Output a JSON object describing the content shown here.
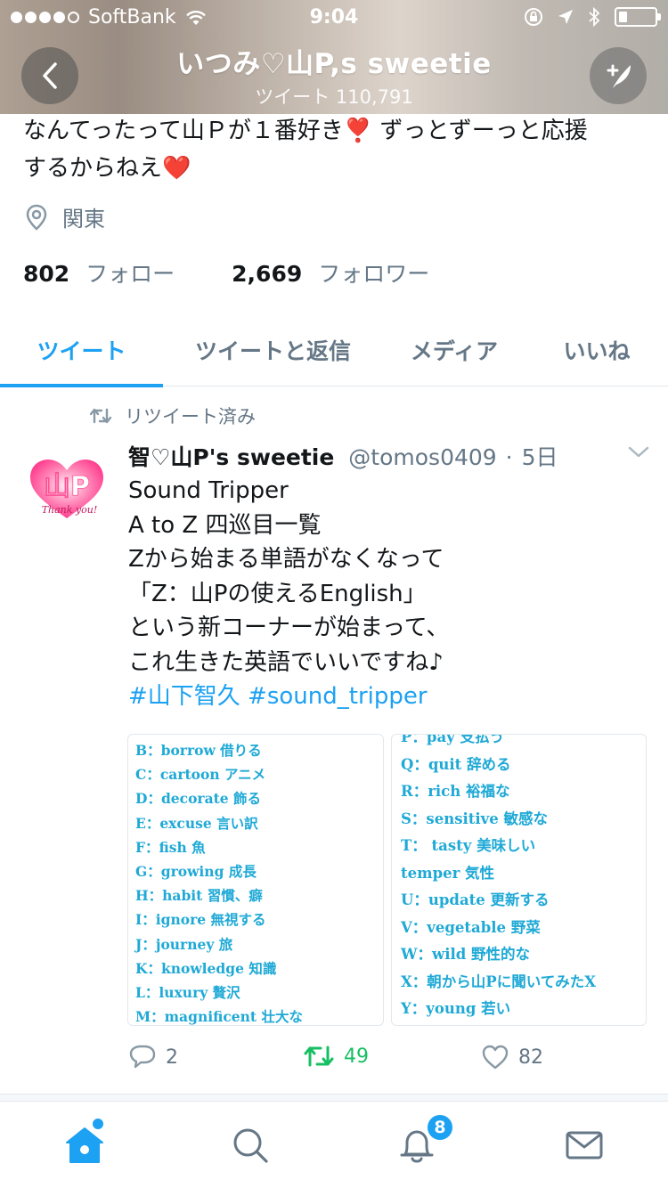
{
  "status_bar": {
    "carrier": "SoftBank",
    "time": "9:04"
  },
  "header": {
    "title": "いつみ♡山P,s  sweetie",
    "subtitle": "ツイート 110,791"
  },
  "profile": {
    "bio_line1": "なんてったって山Ｐが１番好き❣️ ずっとずーっと応援",
    "bio_line2": "するからねえ❤️",
    "location": "関東",
    "following_count": "802",
    "following_label": "フォロー",
    "followers_count": "2,669",
    "followers_label": "フォロワー"
  },
  "tabs": [
    {
      "label": "ツイート",
      "active": true
    },
    {
      "label": "ツイートと返信",
      "active": false
    },
    {
      "label": "メディア",
      "active": false
    },
    {
      "label": "いいね",
      "active": false
    }
  ],
  "tweet": {
    "retweeted_label": "リツイート済み",
    "avatar_text": "山P",
    "avatar_subtext": "Thank you!",
    "author_name": "智♡山P's sweetie",
    "author_handle": "@tomos0409",
    "separator": "·",
    "time": "5日",
    "lines": [
      "Sound Tripper",
      "A to Z 四巡目一覧",
      "Zから始まる単語がなくなって",
      "「Z：山Pの使えるEnglish」",
      "という新コーナーが始まって、",
      "これ生きた英語でいいですね♪"
    ],
    "hashtags": "#山下智久 #sound_tripper",
    "image_left_lines": [
      "B：borrow 借りる",
      "C：cartoon アニメ",
      "D：decorate 飾る",
      "E：excuse 言い訳",
      "F：fish 魚",
      "G：growing 成長",
      "H：habit 習慣、癖",
      "I：ignore 無視する",
      "J：journey 旅",
      "K：knowledge 知識",
      "L：luxury 贅沢",
      "M：magnificent 壮大な"
    ],
    "image_right_lines": [
      "P：pay 支払う",
      "Q：quit 辞める",
      "R：rich 裕福な",
      "S：sensitive 敏感な",
      "T： tasty 美味しい",
      "temper 気性",
      "U：update 更新する",
      "V：vegetable 野菜",
      "W：wild 野性的な",
      "X：朝から山Pに聞いてみたX",
      "Y：young 若い"
    ],
    "reply_count": "2",
    "retweet_count": "49",
    "like_count": "82"
  },
  "bottom_nav": {
    "notification_badge": "8"
  },
  "colors": {
    "accent": "#1da1f2",
    "retweet_green": "#17bf63",
    "muted": "#657786",
    "image_text": "#1fa9d6"
  }
}
